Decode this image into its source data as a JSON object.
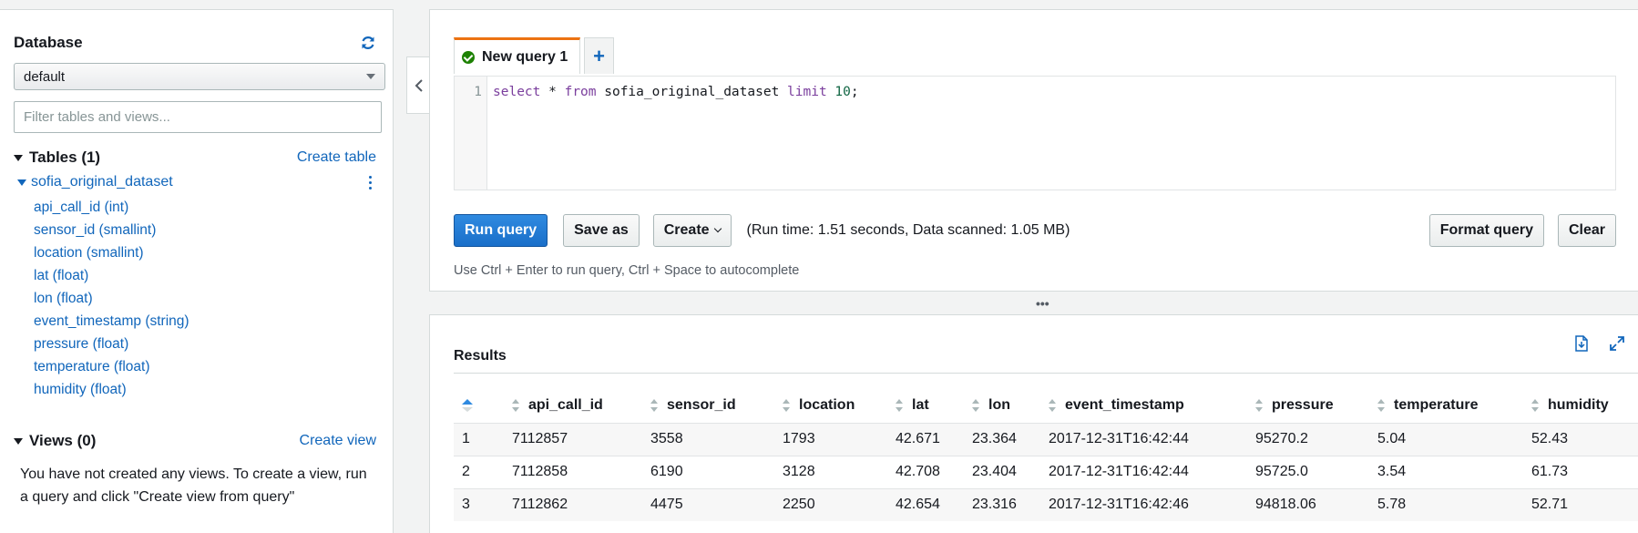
{
  "sidebar": {
    "title": "Database",
    "database_selected": "default",
    "filter_placeholder": "Filter tables and views...",
    "tables_heading": "Tables (1)",
    "create_table": "Create table",
    "dataset_name": "sofia_original_dataset",
    "columns": [
      "api_call_id (int)",
      "sensor_id (smallint)",
      "location (smallint)",
      "lat (float)",
      "lon (float)",
      "event_timestamp (string)",
      "pressure (float)",
      "temperature (float)",
      "humidity (float)"
    ],
    "views_heading": "Views (0)",
    "create_view": "Create view",
    "views_note": "You have not created any views. To create a view, run a query and click \"Create view from query\""
  },
  "editor": {
    "tab_label": "New query 1",
    "tab_add": "+",
    "line_number": "1",
    "query_tokens": {
      "kw_select": "select",
      "star": " * ",
      "kw_from": "from",
      "table": " sofia_original_dataset ",
      "kw_limit": "limit",
      "space": " ",
      "limit_value": "10",
      "terminator": ";"
    },
    "run_label": "Run query",
    "save_as_label": "Save as",
    "create_label": "Create",
    "run_info": "(Run time: 1.51 seconds, Data scanned: 1.05 MB)",
    "format_label": "Format query",
    "clear_label": "Clear",
    "hint": "Use Ctrl + Enter to run query, Ctrl + Space to autocomplete"
  },
  "divider_glyph": "•••",
  "results": {
    "title": "Results",
    "columns": [
      "api_call_id",
      "sensor_id",
      "location",
      "lat",
      "lon",
      "event_timestamp",
      "pressure",
      "temperature",
      "humidity"
    ],
    "rows": [
      [
        "1",
        "7112857",
        "3558",
        "1793",
        "42.671",
        "23.364",
        "2017-12-31T16:42:44",
        "95270.2",
        "5.04",
        "52.43"
      ],
      [
        "2",
        "7112858",
        "6190",
        "3128",
        "42.708",
        "23.404",
        "2017-12-31T16:42:44",
        "95725.0",
        "3.54",
        "61.73"
      ],
      [
        "3",
        "7112862",
        "4475",
        "2250",
        "42.654",
        "23.316",
        "2017-12-31T16:42:46",
        "94818.06",
        "5.78",
        "52.71"
      ]
    ]
  },
  "colors": {
    "accent_blue": "#1166bb",
    "run_button": "#1a6fc9",
    "tab_top": "#ec7211",
    "success": "#1d8102"
  }
}
